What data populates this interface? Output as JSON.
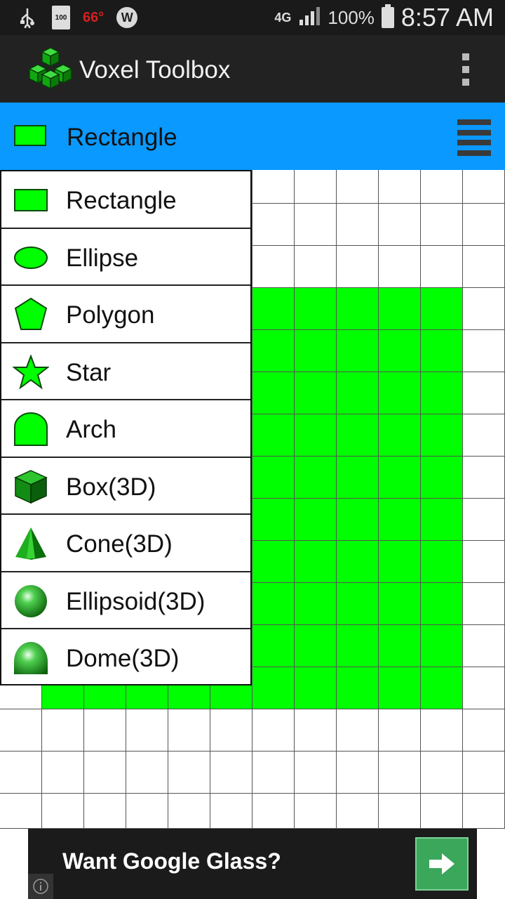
{
  "status_bar": {
    "battery_small": "100",
    "temperature": "66°",
    "w_badge": "W",
    "network": "4G",
    "battery_percent": "100%",
    "time": "8:57 AM"
  },
  "app": {
    "title": "Voxel Toolbox"
  },
  "tool_selector": {
    "selected": "Rectangle"
  },
  "tools": [
    {
      "label": "Rectangle",
      "icon": "rectangle-icon"
    },
    {
      "label": "Ellipse",
      "icon": "ellipse-icon"
    },
    {
      "label": "Polygon",
      "icon": "polygon-icon"
    },
    {
      "label": "Star",
      "icon": "star-icon"
    },
    {
      "label": "Arch",
      "icon": "arch-icon"
    },
    {
      "label": "Box(3D)",
      "icon": "box-3d-icon"
    },
    {
      "label": "Cone(3D)",
      "icon": "cone-3d-icon"
    },
    {
      "label": "Ellipsoid(3D)",
      "icon": "ellipsoid-3d-icon"
    },
    {
      "label": "Dome(3D)",
      "icon": "dome-3d-icon"
    }
  ],
  "ad": {
    "text": "Want Google Glass?"
  },
  "colors": {
    "status_bar": "#1a1a1a",
    "action_bar": "#222222",
    "tool_bar": "#0a99ff",
    "voxel_fill": "#00ff00",
    "ad_button": "#3ba75a"
  }
}
